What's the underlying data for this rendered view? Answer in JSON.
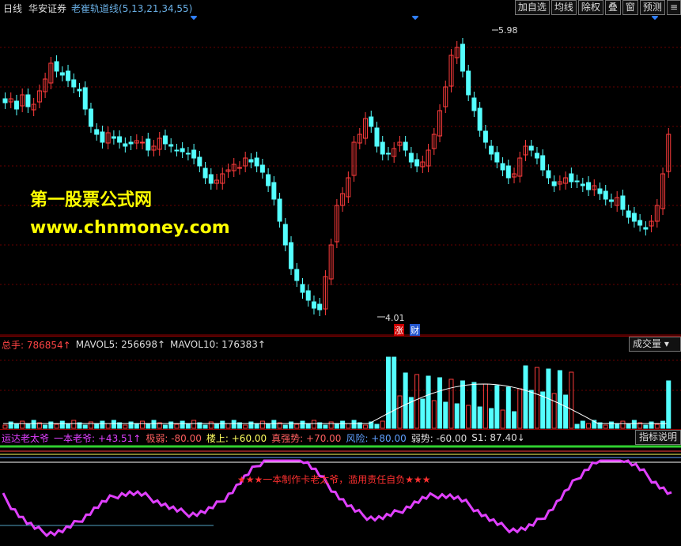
{
  "header": {
    "period": "日线",
    "broker": "华安证券",
    "indicator": "老崔轨道线(5,13,21,34,55)",
    "buttons": [
      "加自选",
      "均线",
      "除权",
      "叠",
      "窗",
      "预测",
      "≡"
    ]
  },
  "main": {
    "high_label": "5.98",
    "low_label": "4.01",
    "marker_zhang": "涨",
    "marker_cai": "财",
    "watermark_title": "第一股票公式网",
    "watermark_url": "www.chnmoney.com"
  },
  "volume": {
    "total_label": "总手: 786854↑",
    "mavol5": "MAVOL5: 256698↑",
    "mavol10": "MAVOL10: 176383↑",
    "selector": "成交量"
  },
  "indicator_panel": {
    "name": "运达老太爷",
    "yiben": "一本老爷: +43.51↑",
    "jiruo": "极弱: -80.00",
    "loushang": "楼上: +60.00",
    "zhenqiang": "真强势: +70.00",
    "fengxian": "风险: +80.00",
    "ruoshi": "弱势: -60.00",
    "s1": "S1: 87.40↓",
    "help_button": "指标说明",
    "banner": "★★★一本制作卡老太爷，滥用责任自负★★★"
  },
  "colors": {
    "up": "#ff3c3c",
    "down": "#54ffff",
    "magenta": "#e040ff",
    "green": "#30d030"
  }
}
